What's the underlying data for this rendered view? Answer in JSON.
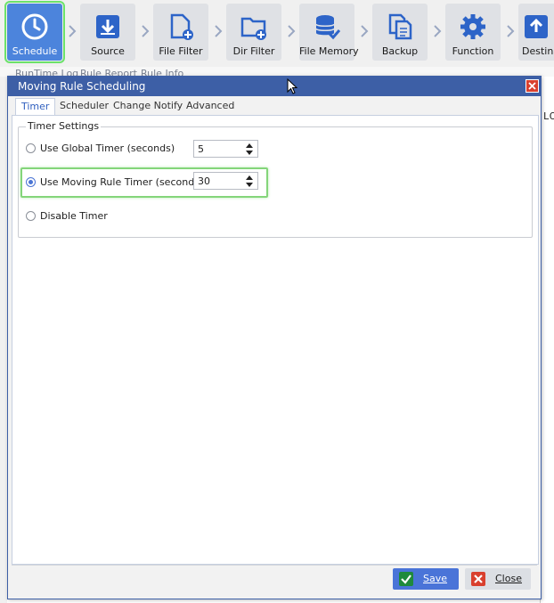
{
  "toolbar": {
    "items": [
      {
        "label": "Schedule",
        "icon": "clock-icon",
        "active": true
      },
      {
        "label": "Source",
        "icon": "download-box-icon"
      },
      {
        "label": "File Filter",
        "icon": "file-add-icon"
      },
      {
        "label": "Dir Filter",
        "icon": "folder-add-icon"
      },
      {
        "label": "File Memory",
        "icon": "database-check-icon"
      },
      {
        "label": "Backup",
        "icon": "copy-documents-icon"
      },
      {
        "label": "Function",
        "icon": "gear-icon"
      },
      {
        "label": "Destina",
        "icon": "upload-box-icon"
      }
    ]
  },
  "subtabs": [
    "RunTime Log",
    "Rule Report",
    "Rule Info"
  ],
  "background_text": "LC",
  "dialog": {
    "title": "Moving Rule Scheduling",
    "tabs": [
      "Timer",
      "Scheduler",
      "Change Notify",
      "Advanced"
    ],
    "active_tab": "Timer",
    "group_title": "Timer Settings",
    "options": [
      {
        "label": "Use Global Timer (seconds)",
        "value": "5",
        "checked": false
      },
      {
        "label": "Use Moving Rule Timer (seconds)",
        "value": "30",
        "checked": true
      },
      {
        "label": "Disable Timer",
        "checked": false
      }
    ],
    "save_label": "Save",
    "close_label": "Close"
  },
  "colors": {
    "accent": "#4a74d8",
    "titlebar": "#3d5fa6",
    "highlight": "#84d57a",
    "close_red": "#d9402e"
  }
}
